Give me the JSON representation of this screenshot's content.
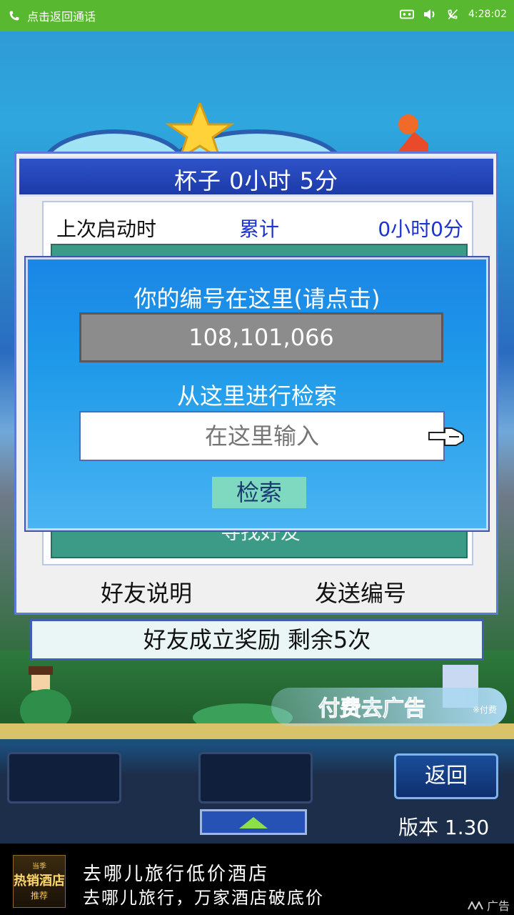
{
  "status_bar": {
    "call_text": "点击返回通话",
    "time": "4:28:02"
  },
  "dialog": {
    "title": "杯子  0小时 5分",
    "last_launch_label": "上次启动时",
    "accumulated_label": "累计",
    "accumulated_value": "0小时0分",
    "find_friend_text": "寻找好友",
    "friend_desc_link": "好友说明",
    "send_id_link": "发送编号"
  },
  "overlay": {
    "title": "你的编号在这里(请点击)",
    "user_id": "108,101,066",
    "search_title": "从这里进行检索",
    "search_placeholder": "在这里输入",
    "search_button": "检索"
  },
  "reward_bar": {
    "text": "好友成立奖励  剩余5次"
  },
  "paid_ads": {
    "label": "付费去广告",
    "note": "※付费"
  },
  "controls": {
    "back_button": "返回",
    "version": "版本 1.30"
  },
  "ad_banner": {
    "thumb_top": "当季",
    "thumb_main": "热销酒店",
    "thumb_sub": "推荐",
    "line1": "去哪儿旅行低价酒店",
    "line2": "去哪儿旅行，万家酒店破底价",
    "tag": "广告"
  }
}
